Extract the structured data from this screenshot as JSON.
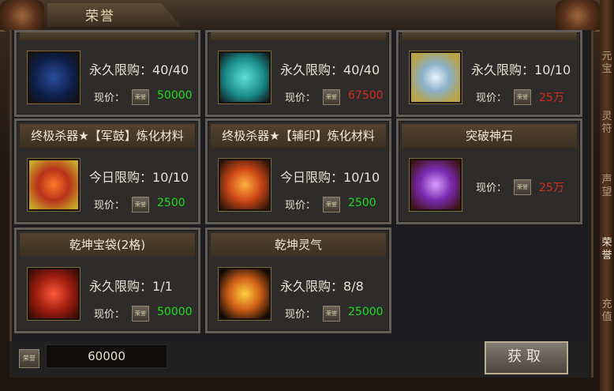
{
  "window": {
    "title": "荣誉"
  },
  "side_tabs": [
    "元宝",
    "灵符",
    "声望",
    "荣誉",
    "充值"
  ],
  "items_top_partial": [
    {
      "limit_label": "永久限购",
      "limit": "40/40",
      "price_label": "现价：",
      "price": "50000",
      "price_color": "green"
    },
    {
      "limit_label": "永久限购",
      "limit": "40/40",
      "price_label": "现价：",
      "price": "67500",
      "price_color": "red"
    },
    {
      "limit_label": "永久限购",
      "limit": "10/10",
      "price_label": "现价：",
      "price": "25万",
      "price_color": "red"
    }
  ],
  "items_mid": [
    {
      "name": "终极杀器★【军鼓】炼化材料",
      "limit_label": "今日限购",
      "limit": "10/10",
      "price_label": "现价：",
      "price": "2500",
      "price_color": "green"
    },
    {
      "name": "终极杀器★【辅印】炼化材料",
      "limit_label": "今日限购",
      "limit": "10/10",
      "price_label": "现价：",
      "price": "2500",
      "price_color": "green"
    },
    {
      "name": "突破神石",
      "price_label": "现价：",
      "price": "25万",
      "price_color": "red"
    }
  ],
  "items_bottom": [
    {
      "name": "乾坤宝袋(2格)",
      "limit_label": "永久限购",
      "limit": "1/1",
      "price_label": "现价：",
      "price": "50000",
      "price_color": "green"
    },
    {
      "name": "乾坤灵气",
      "limit_label": "永久限购",
      "limit": "8/8",
      "price_label": "现价：",
      "price": "25000",
      "price_color": "green"
    }
  ],
  "footer": {
    "currency_icon": "荣誉",
    "total": "60000",
    "get_button": "获取"
  },
  "coin_icon_text": "荣誉"
}
